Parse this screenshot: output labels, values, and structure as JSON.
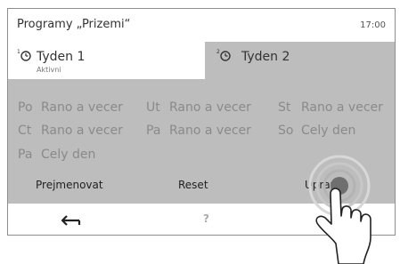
{
  "header": {
    "title": "Programy „Prizemi“",
    "clock": "17:00"
  },
  "tabs": [
    {
      "label": "Tyden 1",
      "sublabel": "Aktivni",
      "icon": "clock-program-1-icon"
    },
    {
      "label": "Tyden 2",
      "icon": "clock-program-2-icon"
    }
  ],
  "schedule": [
    {
      "day": "Po",
      "program": "Rano a vecer"
    },
    {
      "day": "Ut",
      "program": "Rano a vecer"
    },
    {
      "day": "St",
      "program": "Rano a vecer"
    },
    {
      "day": "Ct",
      "program": "Rano a vecer"
    },
    {
      "day": "Pa",
      "program": "Rano a vecer"
    },
    {
      "day": "So",
      "program": "Cely den"
    },
    {
      "day": "Pa",
      "program": "Cely den"
    }
  ],
  "actions": {
    "rename": "Prejmenovat",
    "reset": "Reset",
    "edit": "Upravit"
  },
  "bottom": {
    "back_icon": "back-arrow-icon",
    "help": "?"
  },
  "colors": {
    "panel": "#bdbdbd",
    "text_dim": "#8a8a8a",
    "border": "#8e8e8e"
  }
}
